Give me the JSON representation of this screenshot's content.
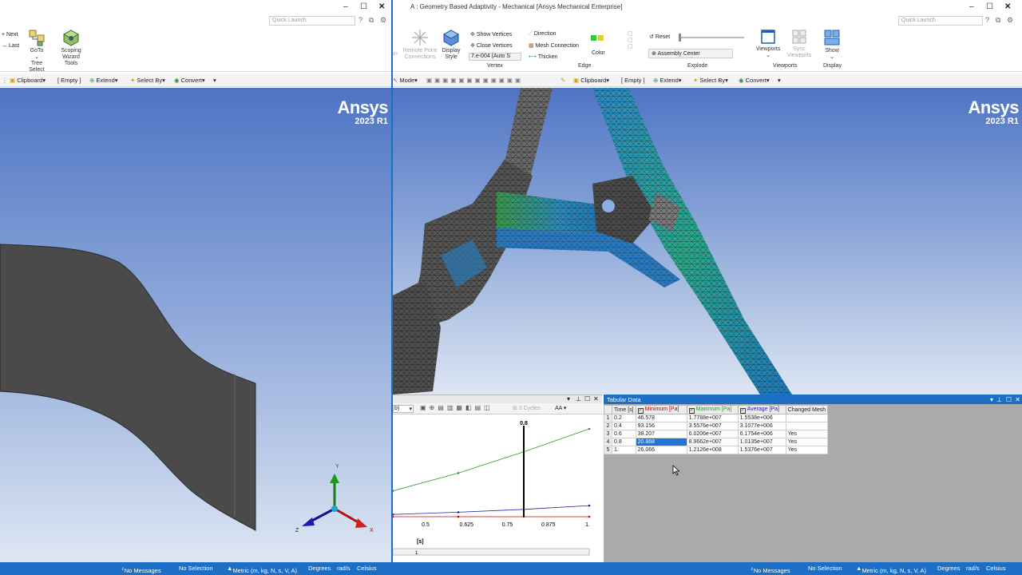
{
  "colors": {
    "accent": "#1c6fc4",
    "min_series": "#c00000",
    "max_series": "#2a9a2a",
    "avg_series": "#2020a0"
  },
  "left": {
    "quick_launch": "Quick Launch",
    "nav": {
      "next": "Next",
      "last": "Last"
    },
    "goto_label": "GoTo",
    "tree_select_label": "Tree Select",
    "scoping_label": "Scoping Wizard Tools",
    "toolbar": {
      "clipboard": "Clipboard",
      "empty": "[ Empty ]",
      "extend": "Extend",
      "select_by": "Select By",
      "convert": "Convert"
    },
    "logo": {
      "brand": "Ansys",
      "version": "2023 R1"
    },
    "triad": {
      "y": "Y",
      "z": "Z",
      "x": "X"
    },
    "status": {
      "messages": "No Messages",
      "selection": "No Selection",
      "units": "Metric (m, kg, N, s, V, A)",
      "degrees": "Degrees",
      "rads": "rad/s",
      "temp": "Celsius"
    }
  },
  "right": {
    "title": "A : Geometry Based Adaptivity - Mechanical [Ansys Mechanical Enterprise]",
    "quick_launch": "Quick Launch",
    "ribbon": {
      "remote_point": "Remote Point Connections",
      "display_style": "Display Style",
      "show_vertices": "Show Vertices",
      "close_vertices": "Close Vertices",
      "vertex_value": "7.e-004 (Auto S",
      "vertex_group": "Vertex",
      "direction": "Direction",
      "mesh_connection": "Mesh Connection",
      "thicken": "Thicken",
      "color": "Color",
      "edge_group": "Edge",
      "reset": "Reset",
      "assembly_center": "Assembly Center",
      "explode_group": "Explode",
      "viewports": "Viewports",
      "sync_viewports": "Sync Viewports",
      "viewports_group": "Viewports",
      "show": "Show",
      "display_group": "Display"
    },
    "toolbar": {
      "mode": "Mode",
      "clipboard": "Clipboard",
      "empty": "[ Empty ]",
      "extend": "Extend",
      "select_by": "Select By",
      "convert": "Convert"
    },
    "logo": {
      "brand": "Ansys",
      "version": "2023 R1"
    },
    "graph": {
      "dropdown": "b)",
      "cycles": "3 Cycles",
      "aa": "AA",
      "marker_label": "0.8",
      "x_axis_label": "[s]",
      "x_ticks": [
        "0.5",
        "0.625",
        "0.75",
        "0.875",
        "1."
      ],
      "slider_value": "1"
    },
    "tabular": {
      "title": "Tabular Data",
      "headers": [
        "Time [s]",
        "Minimum [Pa]",
        "Maximum [Pa]",
        "Average [Pa]",
        "Changed Mesh"
      ],
      "rows": [
        {
          "n": "1",
          "time": "0.2",
          "min": "46.578",
          "max": "1.7788e+007",
          "avg": "1.5538e+006",
          "changed": ""
        },
        {
          "n": "2",
          "time": "0.4",
          "min": "93.156",
          "max": "3.5576e+007",
          "avg": "3.1077e+006",
          "changed": ""
        },
        {
          "n": "3",
          "time": "0.6",
          "min": "38.207",
          "max": "6.0206e+007",
          "avg": "6.1754e+006",
          "changed": "Yes"
        },
        {
          "n": "4",
          "time": "0.8",
          "min": "20.868",
          "max": "8.9662e+007",
          "avg": "1.0135e+007",
          "changed": "Yes"
        },
        {
          "n": "5",
          "time": "1.",
          "min": "26.066",
          "max": "1.2126e+008",
          "avg": "1.5376e+007",
          "changed": "Yes"
        }
      ]
    },
    "status": {
      "messages": "No Messages",
      "selection": "No Selection",
      "units": "Metric (m, kg, N, s, V, A)",
      "degrees": "Degrees",
      "rads": "rad/s",
      "temp": "Celsius"
    }
  },
  "chart_data": {
    "type": "line",
    "x_visible_range": [
      0.4,
      1.0
    ],
    "x": [
      0.2,
      0.4,
      0.6,
      0.8,
      1.0
    ],
    "series": [
      {
        "name": "Minimum [Pa]",
        "color": "#c00000",
        "values": [
          46.578,
          93.156,
          38.207,
          20.868,
          26.066
        ]
      },
      {
        "name": "Maximum [Pa]",
        "color": "#2a9a2a",
        "values": [
          17788000,
          35576000,
          60206000,
          89662000,
          121260000
        ]
      },
      {
        "name": "Average [Pa]",
        "color": "#2020a0",
        "values": [
          1553800,
          3107700,
          6175400,
          10135000,
          15376000
        ]
      }
    ],
    "marker_x": 0.8,
    "x_ticks": [
      0.5,
      0.625,
      0.75,
      0.875,
      1.0
    ],
    "xlabel": "[s]"
  }
}
